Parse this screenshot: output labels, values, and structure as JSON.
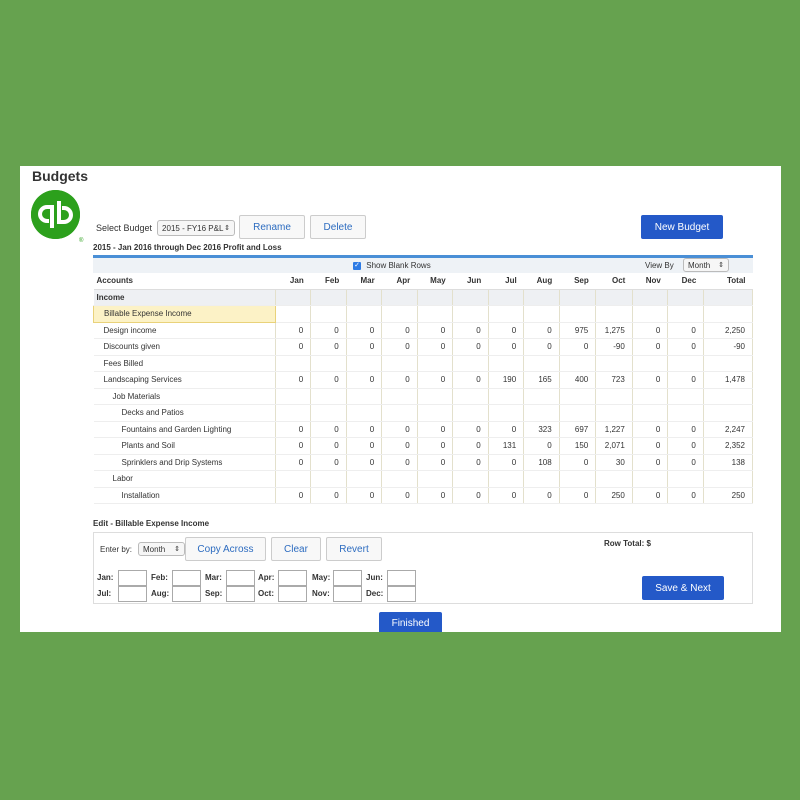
{
  "page": {
    "title": "Budgets"
  },
  "toolbar": {
    "select_label": "Select Budget",
    "select_value": "2015 - FY16 P&L",
    "rename_label": "Rename",
    "delete_label": "Delete",
    "new_budget_label": "New Budget"
  },
  "report": {
    "subtitle": "2015 - Jan 2016 through Dec 2016 Profit and Loss",
    "show_blank_rows_label": "Show Blank Rows",
    "view_by_label": "View By",
    "view_by_value": "Month"
  },
  "table": {
    "headers": [
      "Accounts",
      "Jan",
      "Feb",
      "Mar",
      "Apr",
      "May",
      "Jun",
      "Jul",
      "Aug",
      "Sep",
      "Oct",
      "Nov",
      "Dec",
      "Total"
    ],
    "rows": [
      {
        "account": "Income",
        "type": "section",
        "values": [
          "",
          "",
          "",
          "",
          "",
          "",
          "",
          "",
          "",
          "",
          "",
          "",
          ""
        ]
      },
      {
        "account": "Billable Expense Income",
        "type": "highlight",
        "values": [
          "",
          "",
          "",
          "",
          "",
          "",
          "",
          "",
          "",
          "",
          "",
          "",
          ""
        ]
      },
      {
        "account": "Design income",
        "type": "sub1",
        "values": [
          "0",
          "0",
          "0",
          "0",
          "0",
          "0",
          "0",
          "0",
          "975",
          "1,275",
          "0",
          "0",
          "2,250"
        ]
      },
      {
        "account": "Discounts given",
        "type": "sub1",
        "values": [
          "0",
          "0",
          "0",
          "0",
          "0",
          "0",
          "0",
          "0",
          "0",
          "-90",
          "0",
          "0",
          "-90"
        ]
      },
      {
        "account": "Fees Billed",
        "type": "sub1",
        "values": [
          "",
          "",
          "",
          "",
          "",
          "",
          "",
          "",
          "",
          "",
          "",
          "",
          ""
        ]
      },
      {
        "account": "Landscaping Services",
        "type": "sub1",
        "values": [
          "0",
          "0",
          "0",
          "0",
          "0",
          "0",
          "190",
          "165",
          "400",
          "723",
          "0",
          "0",
          "1,478"
        ]
      },
      {
        "account": "Job Materials",
        "type": "sub2",
        "values": [
          "",
          "",
          "",
          "",
          "",
          "",
          "",
          "",
          "",
          "",
          "",
          "",
          ""
        ]
      },
      {
        "account": "Decks and Patios",
        "type": "sub3",
        "values": [
          "",
          "",
          "",
          "",
          "",
          "",
          "",
          "",
          "",
          "",
          "",
          "",
          ""
        ]
      },
      {
        "account": "Fountains and Garden Lighting",
        "type": "sub3",
        "values": [
          "0",
          "0",
          "0",
          "0",
          "0",
          "0",
          "0",
          "323",
          "697",
          "1,227",
          "0",
          "0",
          "2,247"
        ]
      },
      {
        "account": "Plants and Soil",
        "type": "sub3",
        "values": [
          "0",
          "0",
          "0",
          "0",
          "0",
          "0",
          "131",
          "0",
          "150",
          "2,071",
          "0",
          "0",
          "2,352"
        ]
      },
      {
        "account": "Sprinklers and Drip Systems",
        "type": "sub3",
        "values": [
          "0",
          "0",
          "0",
          "0",
          "0",
          "0",
          "0",
          "108",
          "0",
          "30",
          "0",
          "0",
          "138"
        ]
      },
      {
        "account": "Labor",
        "type": "sub2",
        "values": [
          "",
          "",
          "",
          "",
          "",
          "",
          "",
          "",
          "",
          "",
          "",
          "",
          ""
        ]
      },
      {
        "account": "Installation",
        "type": "sub3",
        "values": [
          "0",
          "0",
          "0",
          "0",
          "0",
          "0",
          "0",
          "0",
          "0",
          "250",
          "0",
          "0",
          "250"
        ]
      }
    ]
  },
  "edit": {
    "title": "Edit - Billable Expense Income",
    "enter_by_label": "Enter by:",
    "enter_by_value": "Month",
    "copy_across_label": "Copy Across",
    "clear_label": "Clear",
    "revert_label": "Revert",
    "row_total_label": "Row Total: $",
    "months": [
      "Jan:",
      "Feb:",
      "Mar:",
      "Apr:",
      "May:",
      "Jun:",
      "Jul:",
      "Aug:",
      "Sep:",
      "Oct:",
      "Nov:",
      "Dec:"
    ],
    "save_next_label": "Save & Next"
  },
  "footer": {
    "finished_label": "Finished"
  },
  "colors": {
    "background": "#66a24f",
    "primary": "#2459c8",
    "logo": "#2ca01c",
    "highlight": "#fcf2c6"
  },
  "icons": {
    "logo": "quickbooks-logo-icon",
    "checkbox": "checkbox-checked-icon",
    "select_arrow": "chevron-updown-icon"
  }
}
